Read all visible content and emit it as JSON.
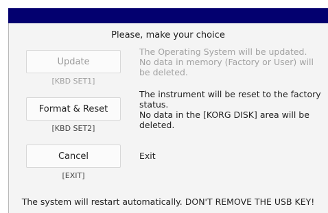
{
  "dialog": {
    "prompt": "Please, make your choice",
    "footer": "The system will restart automatically. DON'T REMOVE THE USB KEY!"
  },
  "options": [
    {
      "button_label": "Update",
      "shortcut": "[KBD SET1]",
      "description": "The Operating System will be updated.\nNo data in memory (Factory or User) will\nbe deleted.",
      "enabled": false
    },
    {
      "button_label": "Format & Reset",
      "shortcut": "[KBD SET2]",
      "description": "The instrument will be reset to the factory\nstatus.\nNo data in the [KORG DISK] area will be\ndeleted.",
      "enabled": true
    },
    {
      "button_label": "Cancel",
      "shortcut": "[EXIT]",
      "description": "Exit",
      "enabled": true
    }
  ],
  "colors": {
    "titlebar": "#03006f",
    "disabled_text": "#a0a0a0"
  }
}
